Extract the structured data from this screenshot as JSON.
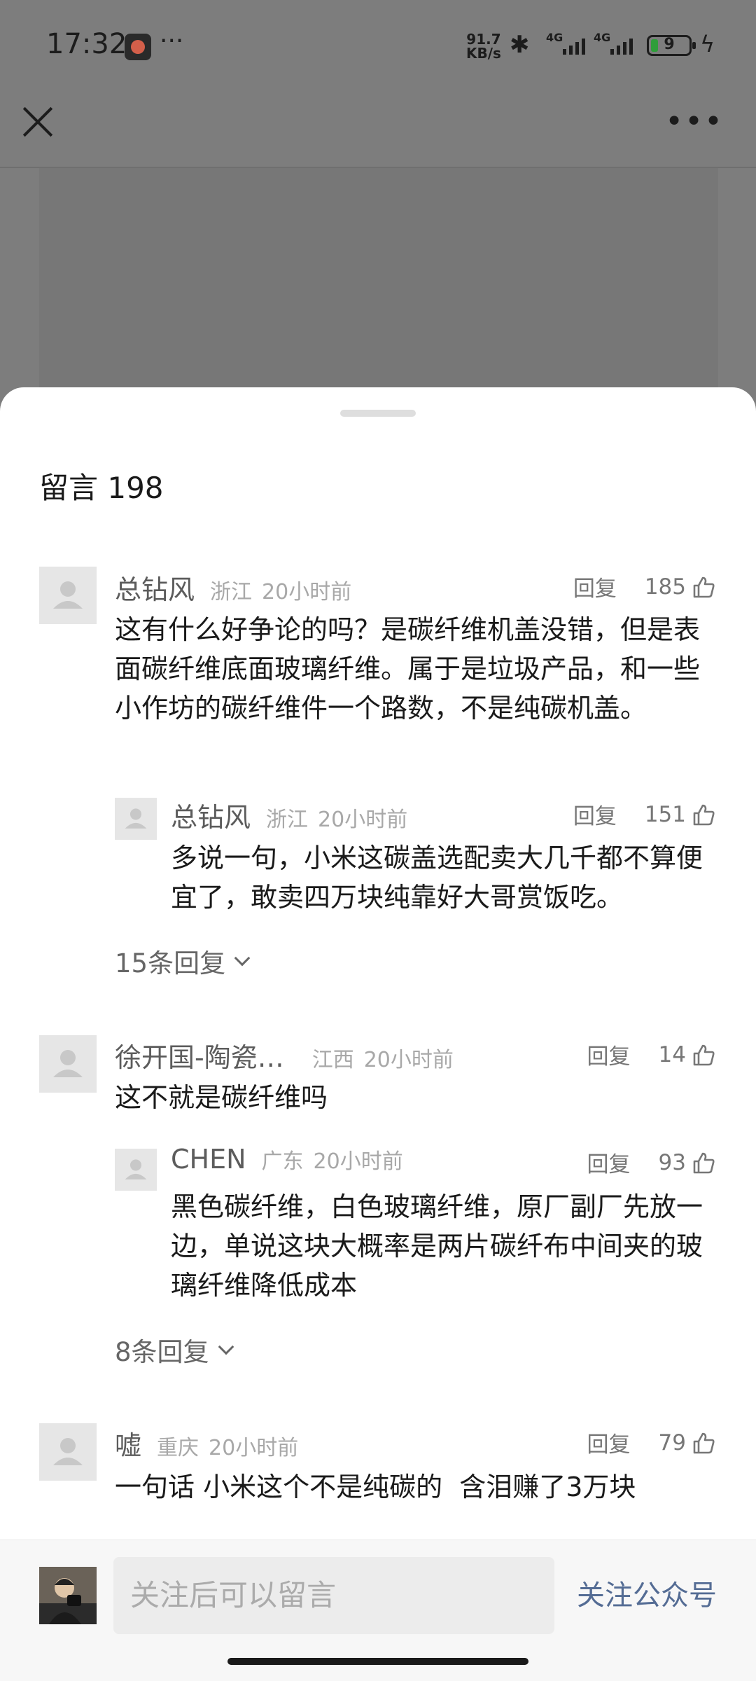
{
  "status_bar": {
    "time": "17:32",
    "dots": "···",
    "net_speed_value": "91.7",
    "net_speed_unit": "KB/s",
    "signal1_label": "4G",
    "signal2_label": "4G",
    "battery_level": "9"
  },
  "header": {
    "close_icon": "close-icon",
    "more_icon": "more-icon"
  },
  "comments_panel": {
    "title": "留言 198",
    "reply_label": "回复",
    "comments": [
      {
        "nickname": "总钻风",
        "location": "浙江",
        "time": "20小时前",
        "likes": "185",
        "text": "这有什么好争论的吗？是碳纤维机盖没错，但是表面碳纤维底面玻璃纤维。属于是垃圾产品，和一些小作坊的碳纤维件一个路数，不是纯碳机盖。",
        "reply": {
          "nickname": "总钻风",
          "location": "浙江",
          "time": "20小时前",
          "likes": "151",
          "text": "多说一句，小米这碳盖选配卖大几千都不算便宜了，敢卖四万块纯靠好大哥赏饭吃。"
        },
        "more_replies": "15条回复"
      },
      {
        "nickname": "徐开国-陶瓷…",
        "location": "江西",
        "time": "20小时前",
        "likes": "14",
        "text": "这不就是碳纤维吗",
        "reply": {
          "nickname": "CHEN",
          "location": "广东",
          "time": "20小时前",
          "likes": "93",
          "text": "黑色碳纤维，白色玻璃纤维，原厂副厂先放一边，单说这块大概率是两片碳纤布中间夹的玻璃纤维降低成本"
        },
        "more_replies": "8条回复"
      },
      {
        "nickname": "嘘",
        "location": "重庆",
        "time": "20小时前",
        "likes": "79",
        "text": "一句话 小米这个不是纯碳的  含泪赚了3万块"
      }
    ]
  },
  "bottom_bar": {
    "input_placeholder": "关注后可以留言",
    "follow_label": "关注公众号"
  },
  "colors": {
    "dim_overlay": "#7d7d7d",
    "follow_link": "#546c94",
    "battery_fill": "#2f9e3a"
  }
}
